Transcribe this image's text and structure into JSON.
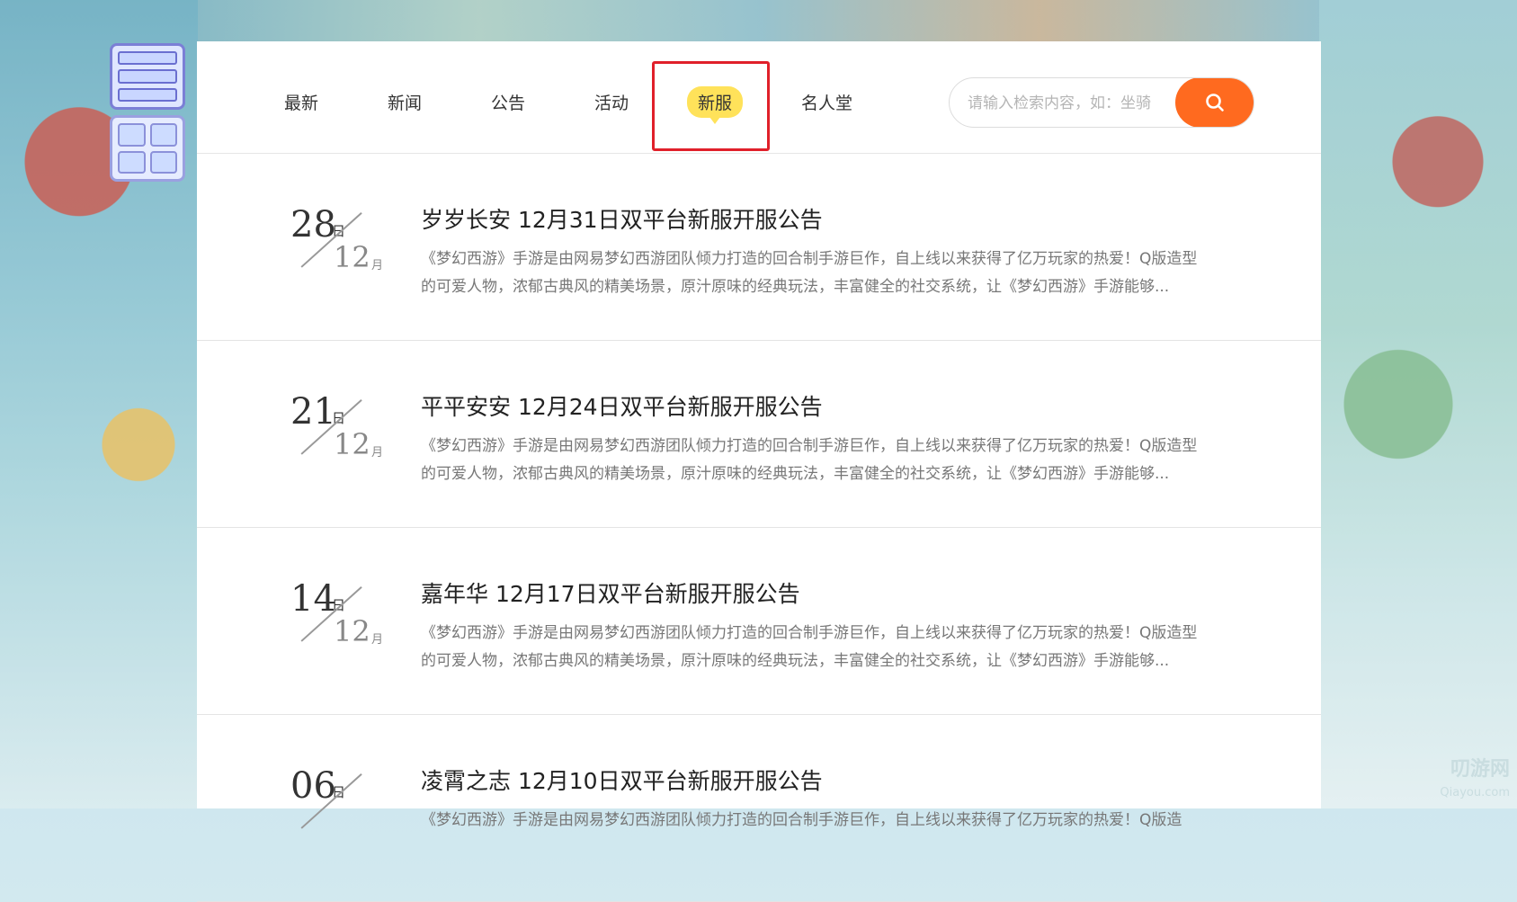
{
  "nav": {
    "tabs": [
      {
        "label": "最新"
      },
      {
        "label": "新闻"
      },
      {
        "label": "公告"
      },
      {
        "label": "活动"
      },
      {
        "label": "新服"
      },
      {
        "label": "名人堂"
      }
    ],
    "active_tab": "新服",
    "search_placeholder": "请输入检索内容，如：坐骑"
  },
  "date_units": {
    "day": "日",
    "month": "月"
  },
  "articles": [
    {
      "day": "28",
      "month": "12",
      "title": "岁岁长安 12月31日双平台新服开服公告",
      "desc": "《梦幻西游》手游是由网易梦幻西游团队倾力打造的回合制手游巨作，自上线以来获得了亿万玩家的热爱！Q版造型的可爱人物，浓郁古典风的精美场景，原汁原味的经典玩法，丰富健全的社交系统，让《梦幻西游》手游能够..."
    },
    {
      "day": "21",
      "month": "12",
      "title": "平平安安 12月24日双平台新服开服公告",
      "desc": "《梦幻西游》手游是由网易梦幻西游团队倾力打造的回合制手游巨作，自上线以来获得了亿万玩家的热爱！Q版造型的可爱人物，浓郁古典风的精美场景，原汁原味的经典玩法，丰富健全的社交系统，让《梦幻西游》手游能够..."
    },
    {
      "day": "14",
      "month": "12",
      "title": "嘉年华 12月17日双平台新服开服公告",
      "desc": "《梦幻西游》手游是由网易梦幻西游团队倾力打造的回合制手游巨作，自上线以来获得了亿万玩家的热爱！Q版造型的可爱人物，浓郁古典风的精美场景，原汁原味的经典玩法，丰富健全的社交系统，让《梦幻西游》手游能够..."
    },
    {
      "day": "06",
      "month": "",
      "title": "凌霄之志 12月10日双平台新服开服公告",
      "desc": "《梦幻西游》手游是由网易梦幻西游团队倾力打造的回合制手游巨作，自上线以来获得了亿万玩家的热爱！Q版造"
    }
  ],
  "watermark": {
    "name": "叨游网",
    "url": "Qiayou.com"
  },
  "colors": {
    "accent": "#ff6a1f",
    "active_tab_bg": "#ffe25a",
    "highlight": "#e0202a"
  }
}
